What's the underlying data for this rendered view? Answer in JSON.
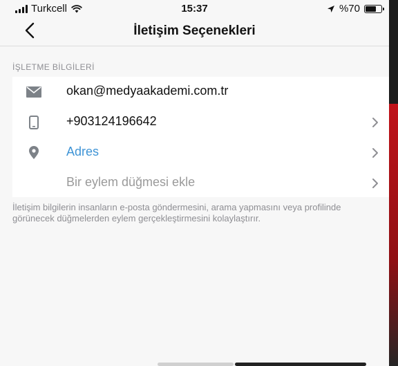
{
  "status_bar": {
    "carrier": "Turkcell",
    "time": "15:37",
    "battery_text": "%70",
    "battery_level": 0.7
  },
  "nav": {
    "title": "İletişim Seçenekleri"
  },
  "section": {
    "header": "İŞLETME BİLGİLERİ"
  },
  "rows": [
    {
      "icon": "mail-icon",
      "label": "okan@medyaakademi.com.tr",
      "chevron": false
    },
    {
      "icon": "phone-icon",
      "label": "+903124196642",
      "chevron": true
    },
    {
      "icon": "location-pin-icon",
      "label": "Adres",
      "chevron": true
    },
    {
      "icon": "",
      "label": "Bir eylem düğmesi ekle",
      "chevron": true
    }
  ],
  "footer": {
    "note": "İletişim bilgilerin insanların e-posta göndermesini, arama yapmasını veya profilinde görünecek düğmelerden eylem gerçekleştirmesini kolaylaştırır."
  },
  "colors": {
    "link": "#3f94d6",
    "muted": "#9a9a9a",
    "icon_gray": "#7d8288"
  }
}
